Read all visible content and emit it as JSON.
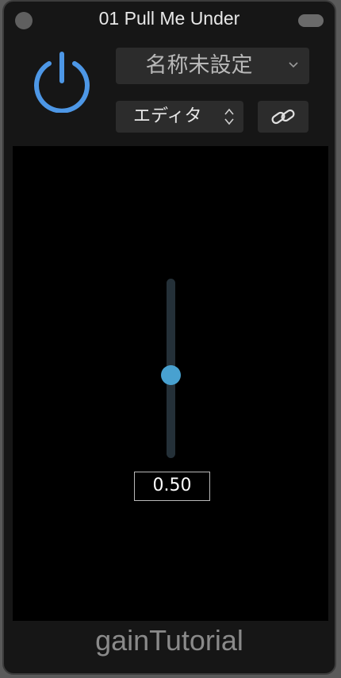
{
  "window": {
    "title": "01 Pull Me Under"
  },
  "controls": {
    "preset_label": "名称未設定",
    "mode_label": "エディタ"
  },
  "slider": {
    "value": 0.5,
    "value_text": "0.50",
    "accent_color": "#48a1d0"
  },
  "footer": {
    "plugin_name": "gainTutorial"
  },
  "icons": {
    "power": "power-icon",
    "preset_chevron": "chevron-down-icon",
    "mode_arrows": "up-down-arrows-icon",
    "link": "link-icon"
  },
  "colors": {
    "power_blue": "#4d97e6",
    "accent": "#48a1d0"
  }
}
